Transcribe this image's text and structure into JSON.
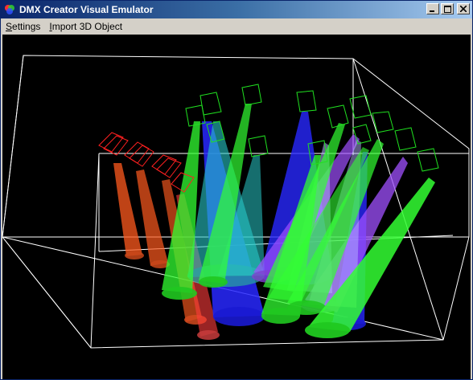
{
  "window": {
    "title": "DMX Creator Visual Emulator",
    "icon": "dmx-app-icon",
    "controls": {
      "minimize_icon": "minimize-icon",
      "maximize_icon": "maximize-icon",
      "close_icon": "close-icon"
    }
  },
  "menu": {
    "items": [
      {
        "label_ul": "S",
        "label_rest": "ettings"
      },
      {
        "label_ul": "I",
        "label_rest": "mport 3D Object"
      }
    ]
  },
  "scene": {
    "background": "#000000",
    "wireframe_color": "#ffffff",
    "beam_colors": {
      "orange": "#ff5a1e",
      "blue": "#2828ff",
      "green": "#32ff32",
      "cyan": "#28c8c8",
      "purple": "#a050ff",
      "lavender": "#b4b4ff",
      "red": "#ff3c3c"
    },
    "fixture_colors": {
      "red_fixture": "#ff2020",
      "green_fixture": "#20e020"
    }
  }
}
